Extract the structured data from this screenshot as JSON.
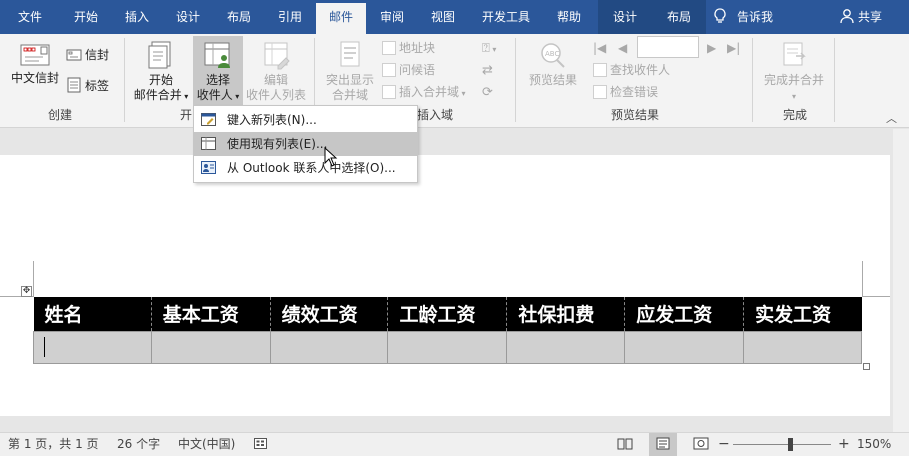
{
  "tabs": [
    {
      "label": "文件",
      "active": false
    },
    {
      "label": "开始",
      "active": false
    },
    {
      "label": "插入",
      "active": false
    },
    {
      "label": "设计",
      "active": false
    },
    {
      "label": "布局",
      "active": false
    },
    {
      "label": "引用",
      "active": false
    },
    {
      "label": "邮件",
      "active": true
    },
    {
      "label": "审阅",
      "active": false
    },
    {
      "label": "视图",
      "active": false
    },
    {
      "label": "开发工具",
      "active": false
    },
    {
      "label": "帮助",
      "active": false
    },
    {
      "label": "设计",
      "active": false
    },
    {
      "label": "布局",
      "active": false
    }
  ],
  "tell_me": "告诉我",
  "share": "共享",
  "ribbon": {
    "create": {
      "label": "创建",
      "envelope": "中文信封",
      "envelopes": "信封",
      "labels": "标签"
    },
    "start_merge": {
      "line1": "开始",
      "line2": "邮件合并",
      "group_partial": "开"
    },
    "select_recipients": {
      "line1": "选择",
      "line2": "收件人"
    },
    "edit_list": {
      "line1": "编辑",
      "line2": "收件人列表"
    },
    "write_insert": {
      "label": "插入域",
      "highlight": {
        "line1": "突出显示",
        "line2": "合并域"
      },
      "address_block": "地址块",
      "greeting": "问候语",
      "insert_field": "插入合并域"
    },
    "preview": {
      "label": "预览结果",
      "button": "预览结果",
      "find": "查找收件人",
      "check": "检查错误"
    },
    "finish": {
      "label": "完成",
      "button": "完成并合并"
    }
  },
  "dropdown": {
    "items": [
      {
        "label": "键入新列表(N)...",
        "icon": "new-list-icon"
      },
      {
        "label": "使用现有列表(E)...",
        "icon": "existing-list-icon",
        "highlighted": true
      },
      {
        "label": "从 Outlook 联系人中选择(O)...",
        "icon": "outlook-contacts-icon"
      }
    ]
  },
  "table": {
    "headers": [
      "姓名",
      "基本工资",
      "绩效工资",
      "工龄工资",
      "社保扣费",
      "应发工资",
      "实发工资"
    ]
  },
  "status": {
    "page": "第 1 页，共 1 页",
    "words": "26 个字",
    "language": "中文(中国)",
    "zoom": "150%"
  }
}
